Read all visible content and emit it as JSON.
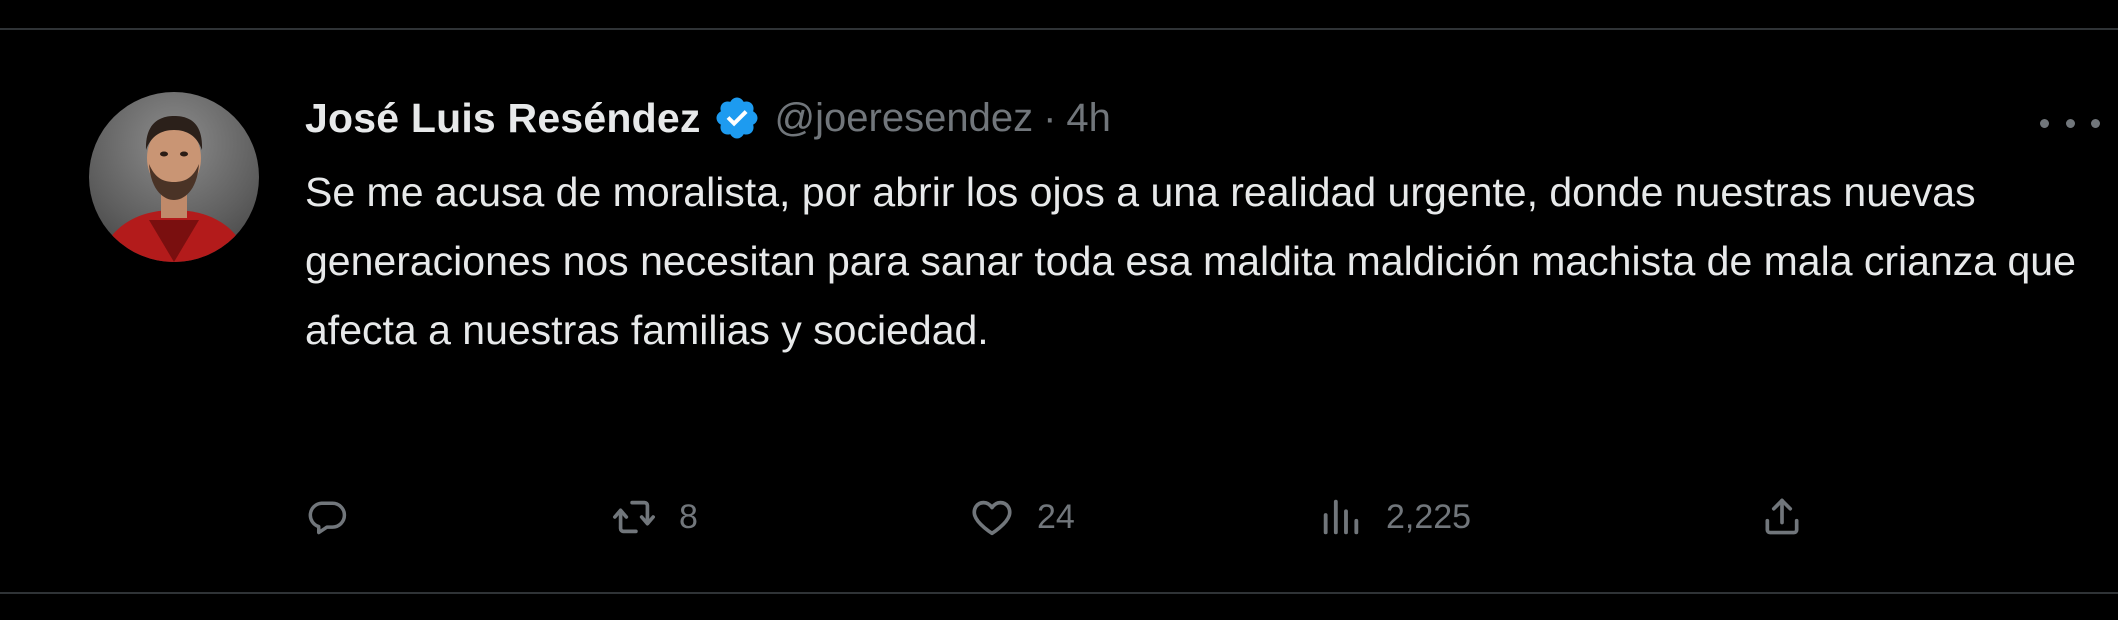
{
  "tweet": {
    "author": {
      "name": "José Luis Reséndez",
      "handle": "@joeresendez",
      "verified": true,
      "verified_color": "#1d9bf0"
    },
    "separator": "·",
    "time": "4h",
    "text": "Se me acusa de moralista, por abrir los ojos a una realidad urgente, donde nuestras nuevas generaciones nos necesitan para sanar toda esa maldita maldición machista de mala crianza que afecta a nuestras familias y sociedad.",
    "metrics": {
      "replies": "",
      "reposts": "8",
      "likes": "24",
      "views": "2,225"
    }
  },
  "icons": {
    "more": "more-dots-icon",
    "reply": "reply-bubble-icon",
    "repost": "repost-icon",
    "like": "heart-icon",
    "views": "views-bar-chart-icon",
    "share": "share-upload-icon",
    "verified": "verified-badge-icon"
  },
  "colors": {
    "background": "#000000",
    "text_primary": "#e7e9ea",
    "text_secondary": "#71767b",
    "divider": "#2f3336"
  }
}
